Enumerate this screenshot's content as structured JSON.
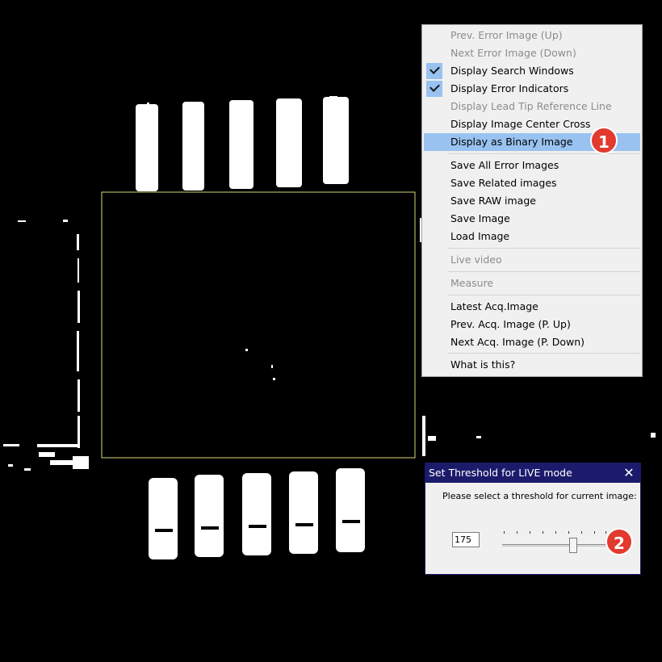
{
  "viewer": {
    "roi_color": "#d6d67a",
    "image": "binary thresholded chip image with white leads"
  },
  "context_menu": {
    "items": [
      {
        "label": "Prev. Error Image (Up)",
        "enabled": false,
        "checked": false
      },
      {
        "label": "Next Error Image (Down)",
        "enabled": false,
        "checked": false
      },
      {
        "label": "Display Search Windows",
        "enabled": true,
        "checked": true
      },
      {
        "label": "Display Error Indicators",
        "enabled": true,
        "checked": true
      },
      {
        "label": "Display Lead Tip Reference Line",
        "enabled": false,
        "checked": false
      },
      {
        "label": "Display Image Center Cross",
        "enabled": true,
        "checked": false
      },
      {
        "label": "Display as Binary Image",
        "enabled": true,
        "checked": false,
        "highlighted": true
      },
      {
        "label": "Save All Error Images",
        "enabled": true,
        "checked": false
      },
      {
        "label": "Save Related images",
        "enabled": true,
        "checked": false
      },
      {
        "label": "Save RAW image",
        "enabled": true,
        "checked": false
      },
      {
        "label": "Save Image",
        "enabled": true,
        "checked": false
      },
      {
        "label": "Load Image",
        "enabled": true,
        "checked": false
      },
      {
        "label": "Live video",
        "enabled": false,
        "checked": false
      },
      {
        "label": "Measure",
        "enabled": false,
        "checked": false
      },
      {
        "label": "Latest Acq.Image",
        "enabled": true,
        "checked": false
      },
      {
        "label": "Prev. Acq. Image (P. Up)",
        "enabled": true,
        "checked": false
      },
      {
        "label": "Next Acq. Image (P. Down)",
        "enabled": true,
        "checked": false
      },
      {
        "label": "What is this?",
        "enabled": true,
        "checked": false
      }
    ],
    "highlight_color": "#99c2f0"
  },
  "annotations": {
    "badge1": "1",
    "badge2": "2",
    "color": "#e23a2e"
  },
  "threshold_dialog": {
    "title": "Set Threshold for LIVE mode",
    "close_glyph": "✕",
    "prompt": "Please select a threshold for current image:",
    "value": "175",
    "slider_fraction": 0.68,
    "title_color": "#1b1a6b"
  }
}
